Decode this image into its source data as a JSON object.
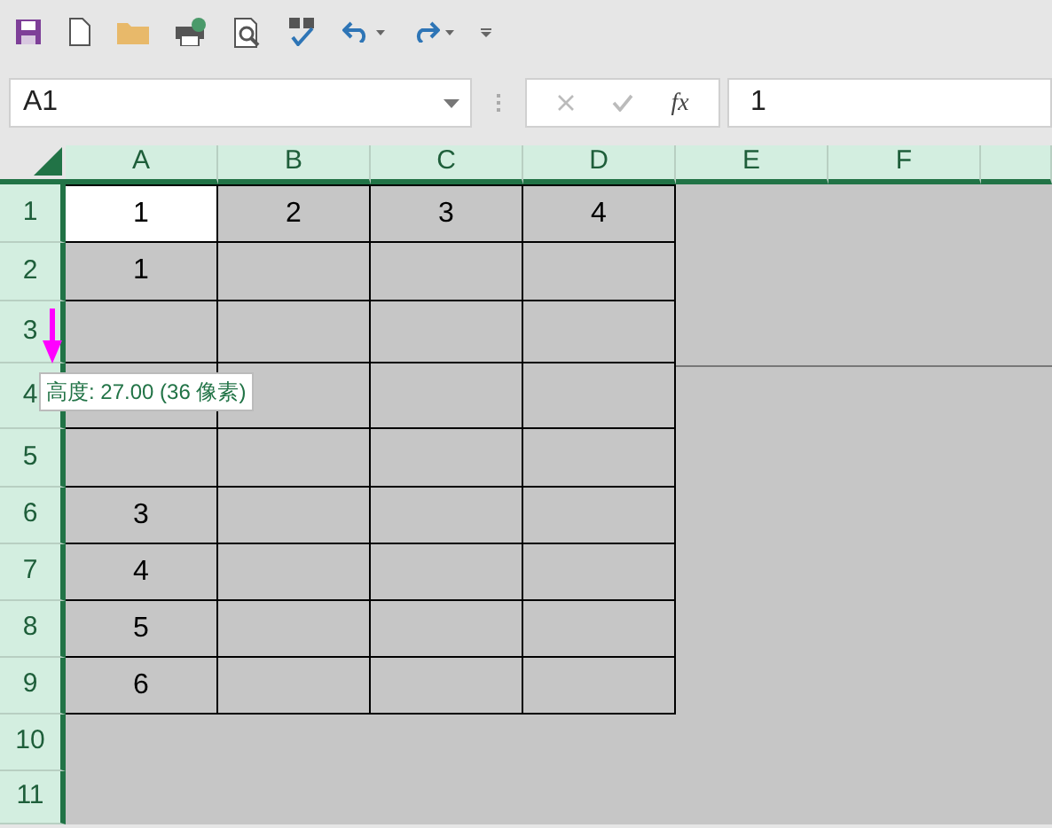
{
  "name_box": {
    "value": "A1"
  },
  "formula_bar": {
    "fx_label": "fx",
    "value": "1"
  },
  "columns": [
    "A",
    "B",
    "C",
    "D",
    "E",
    "F"
  ],
  "rows": [
    {
      "label": "1",
      "cells": [
        {
          "text": "1",
          "selected": true
        },
        {
          "text": "2",
          "selected": false
        },
        {
          "text": "3",
          "selected": false
        },
        {
          "text": "4",
          "selected": false
        }
      ]
    },
    {
      "label": "2",
      "cells": [
        {
          "text": "1",
          "selected": false
        },
        {
          "selected": false
        },
        {
          "selected": false
        },
        {
          "selected": false
        }
      ]
    },
    {
      "label": "3",
      "cells": [
        {
          "selected": false
        },
        {
          "selected": false
        },
        {
          "selected": false
        },
        {
          "selected": false
        }
      ]
    },
    {
      "label": "4",
      "cells": [
        {
          "selected": false
        },
        {
          "selected": false
        },
        {
          "selected": false
        },
        {
          "selected": false
        }
      ]
    },
    {
      "label": "5",
      "cells": [
        {
          "selected": false
        },
        {
          "selected": false
        },
        {
          "selected": false
        },
        {
          "selected": false
        }
      ]
    },
    {
      "label": "6",
      "cells": [
        {
          "text": "3",
          "selected": false
        },
        {
          "selected": false
        },
        {
          "selected": false
        },
        {
          "selected": false
        }
      ]
    },
    {
      "label": "7",
      "cells": [
        {
          "text": "4",
          "selected": false
        },
        {
          "selected": false
        },
        {
          "selected": false
        },
        {
          "selected": false
        }
      ]
    },
    {
      "label": "8",
      "cells": [
        {
          "text": "5",
          "selected": false
        },
        {
          "selected": false
        },
        {
          "selected": false
        },
        {
          "selected": false
        }
      ]
    },
    {
      "label": "9",
      "cells": [
        {
          "text": "6",
          "selected": false
        },
        {
          "selected": false
        },
        {
          "selected": false
        },
        {
          "selected": false
        }
      ]
    },
    {
      "label": "10"
    },
    {
      "label": "11"
    }
  ],
  "resize_tooltip": {
    "text": "高度: 27.00 (36 像素)"
  }
}
